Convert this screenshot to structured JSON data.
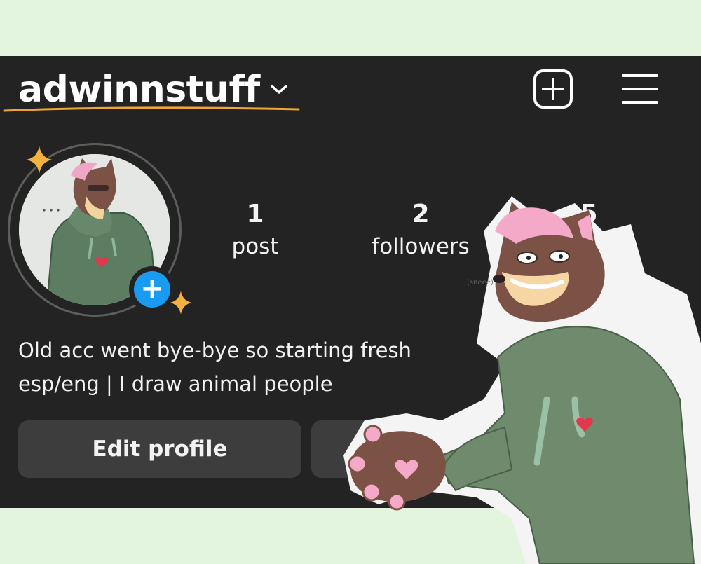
{
  "header": {
    "username": "adwinnstuff",
    "account_switcher_icon": "chevron-down-icon",
    "create_icon": "plus-square-icon",
    "menu_icon": "hamburger-menu-icon"
  },
  "profile": {
    "add_story_glyph": "+",
    "stats": [
      {
        "value": "1",
        "label": "post"
      },
      {
        "value": "2",
        "label": "followers"
      },
      {
        "value": "5",
        "label": ""
      }
    ],
    "bio_lines": [
      "Old acc went bye-bye so starting fresh",
      "esp/eng | I draw animal people"
    ],
    "edit_profile_label": "Edit profile"
  },
  "decorations": {
    "sticker_caption": "(sneee)"
  },
  "colors": {
    "background": "#e3f4df",
    "panel": "#222322",
    "accent_blue": "#1a9bf2",
    "underline_orange": "#f0a43a",
    "button": "#3c3d3c"
  }
}
